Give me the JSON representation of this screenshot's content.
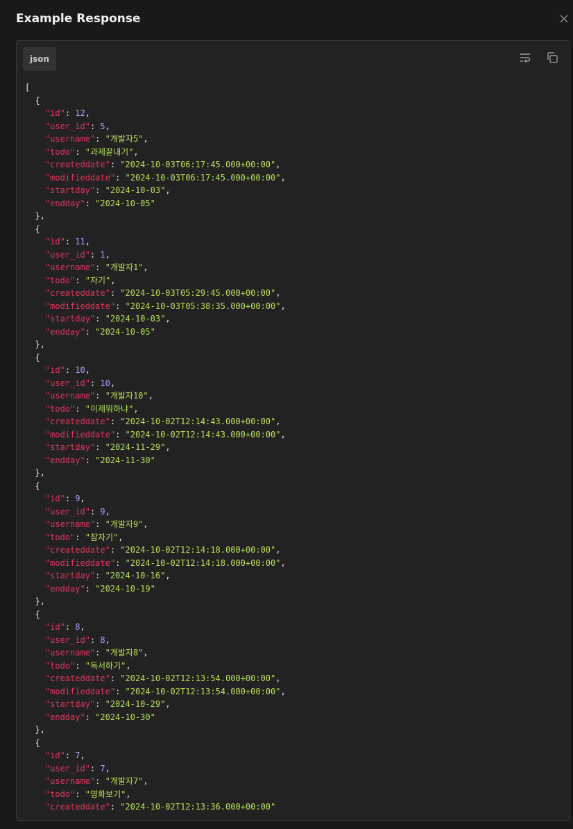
{
  "dialog": {
    "title": "Example Response",
    "language_tab": "json",
    "icons": {
      "close": "close-icon",
      "wrap": "wrap-lines-icon",
      "copy": "copy-icon"
    }
  },
  "colors": {
    "key": "#e0365f",
    "number": "#b39dff",
    "string": "#b8e05a",
    "punctuation": "#e6e6e6",
    "background": "#222222"
  },
  "response": [
    {
      "id": 12,
      "user_id": 5,
      "username": "개발자5",
      "todo": "과제끝내기",
      "createddate": "2024-10-03T06:17:45.000+00:00",
      "modifieddate": "2024-10-03T06:17:45.000+00:00",
      "startday": "2024-10-03",
      "endday": "2024-10-05"
    },
    {
      "id": 11,
      "user_id": 1,
      "username": "개발자1",
      "todo": "자기",
      "createddate": "2024-10-03T05:29:45.000+00:00",
      "modifieddate": "2024-10-03T05:38:35.000+00:00",
      "startday": "2024-10-03",
      "endday": "2024-10-05"
    },
    {
      "id": 10,
      "user_id": 10,
      "username": "개발자10",
      "todo": "이제뭐하냐",
      "createddate": "2024-10-02T12:14:43.000+00:00",
      "modifieddate": "2024-10-02T12:14:43.000+00:00",
      "startday": "2024-11-29",
      "endday": "2024-11-30"
    },
    {
      "id": 9,
      "user_id": 9,
      "username": "개발자9",
      "todo": "잠자기",
      "createddate": "2024-10-02T12:14:18.000+00:00",
      "modifieddate": "2024-10-02T12:14:18.000+00:00",
      "startday": "2024-10-16",
      "endday": "2024-10-19"
    },
    {
      "id": 8,
      "user_id": 8,
      "username": "개발자8",
      "todo": "독서하기",
      "createddate": "2024-10-02T12:13:54.000+00:00",
      "modifieddate": "2024-10-02T12:13:54.000+00:00",
      "startday": "2024-10-29",
      "endday": "2024-10-30"
    },
    {
      "id": 7,
      "user_id": 7,
      "username": "개발자7",
      "todo": "영화보기",
      "createddate": "2024-10-02T12:13:36.000+00:00"
    }
  ]
}
